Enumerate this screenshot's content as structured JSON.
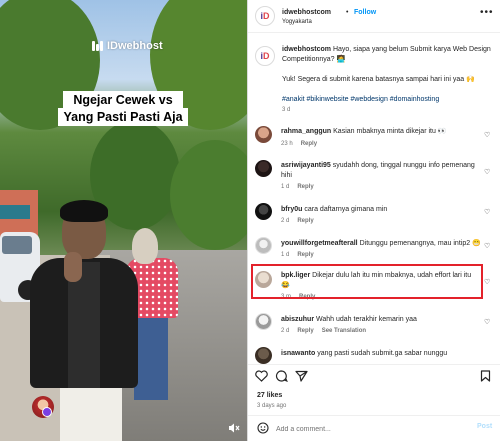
{
  "video": {
    "brand": "IDwebhost",
    "caption_line1": "Ngejar Cewek vs",
    "caption_line2": "Yang Pasti Pasti Aja"
  },
  "header": {
    "username": "idwebhostcom",
    "separator": "•",
    "follow_label": "Follow",
    "location": "Yogyakarta",
    "more_icon": "more-horizontal-icon"
  },
  "post": {
    "username": "idwebhostcom",
    "caption": "Hayo, siapa yang belum Submit karya Web Design Competitionnya? 🧑‍💻",
    "line2": "Yuk! Segera di submit karena batasnya sampai hari ini yaa 🙌",
    "hashtags": "#anakit #bikinwebsite #webdesign #domainhosting",
    "time": "3 d"
  },
  "comments": [
    {
      "username": "rahma_anggun",
      "text": "Kasian mbaknya minta dikejar itu 👀",
      "time": "23 h",
      "reply": "Reply",
      "extra": ""
    },
    {
      "username": "asriwijayanti95",
      "text": "syudahh dong, tinggal nunggu info pemenang hihi",
      "time": "1 d",
      "reply": "Reply",
      "extra": ""
    },
    {
      "username": "bfry0u",
      "text": "cara daftarnya gimana min",
      "time": "2 d",
      "reply": "Reply",
      "extra": ""
    },
    {
      "username": "youwillforgetmeafterall",
      "text": "Ditunggu pemenangnya, mau intip2 😁",
      "time": "1 d",
      "reply": "Reply",
      "extra": ""
    },
    {
      "username": "bpk.liger",
      "text": "Dikejar dulu lah itu min mbaknya, udah effort lari itu 😂",
      "time": "3 m",
      "reply": "Reply",
      "extra": ""
    },
    {
      "username": "abiszuhur",
      "text": "Wahh udah terakhir kemarin yaa",
      "time": "2 d",
      "reply": "Reply",
      "extra": "See Translation"
    },
    {
      "username": "isnawanto",
      "text": "yang pasti sudah submit.ga sabar nunggu",
      "time": "",
      "reply": "",
      "extra": ""
    }
  ],
  "footer": {
    "likes": "27 likes",
    "ago": "3 days ago",
    "comment_placeholder": "Add a comment...",
    "post_label": "Post"
  },
  "colors": {
    "accent": "#0095f6",
    "highlight": "#e3222b",
    "text": "#262626",
    "muted": "#737373"
  }
}
